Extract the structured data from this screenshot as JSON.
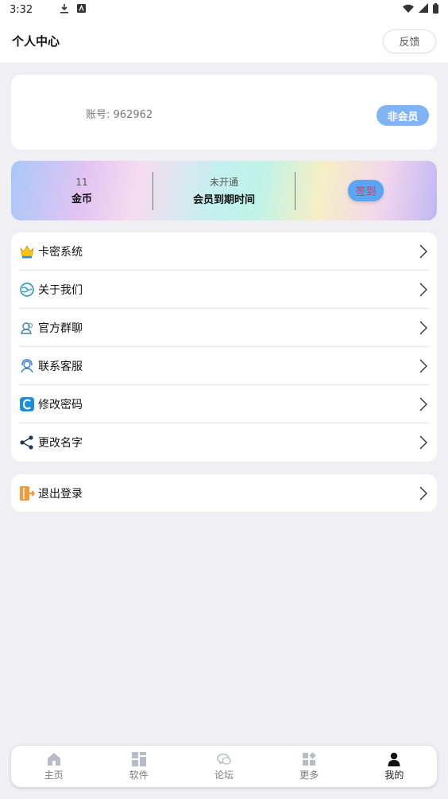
{
  "status_bar": {
    "time": "3:32"
  },
  "header": {
    "title": "个人中心",
    "feedback_label": "反馈"
  },
  "account": {
    "label": "账号: 962962",
    "member_status": "非会员"
  },
  "stats": {
    "coins_value": "11",
    "coins_label": "金币",
    "vip_value": "未开通",
    "vip_label": "会员到期时间",
    "signin_label": "签到"
  },
  "menu": {
    "items": [
      {
        "label": "卡密系统",
        "icon": "crown-icon"
      },
      {
        "label": "关于我们",
        "icon": "globe-icon"
      },
      {
        "label": "官方群聊",
        "icon": "group-chat-icon"
      },
      {
        "label": "联系客服",
        "icon": "customer-service-icon"
      },
      {
        "label": "修改密码",
        "icon": "password-icon"
      },
      {
        "label": "更改名字",
        "icon": "share-icon"
      }
    ]
  },
  "logout": {
    "label": "退出登录"
  },
  "tabbar": {
    "tabs": [
      {
        "label": "主页",
        "icon": "home-icon"
      },
      {
        "label": "软件",
        "icon": "apps-grid-icon"
      },
      {
        "label": "论坛",
        "icon": "forum-icon"
      },
      {
        "label": "更多",
        "icon": "more-grid-icon"
      },
      {
        "label": "我的",
        "icon": "user-icon"
      }
    ],
    "active_index": 4
  },
  "colors": {
    "background": "#efeff4",
    "member_badge": "#7fb3f5",
    "signin_button": "#5aa6f5",
    "signin_text": "#e0345a"
  }
}
